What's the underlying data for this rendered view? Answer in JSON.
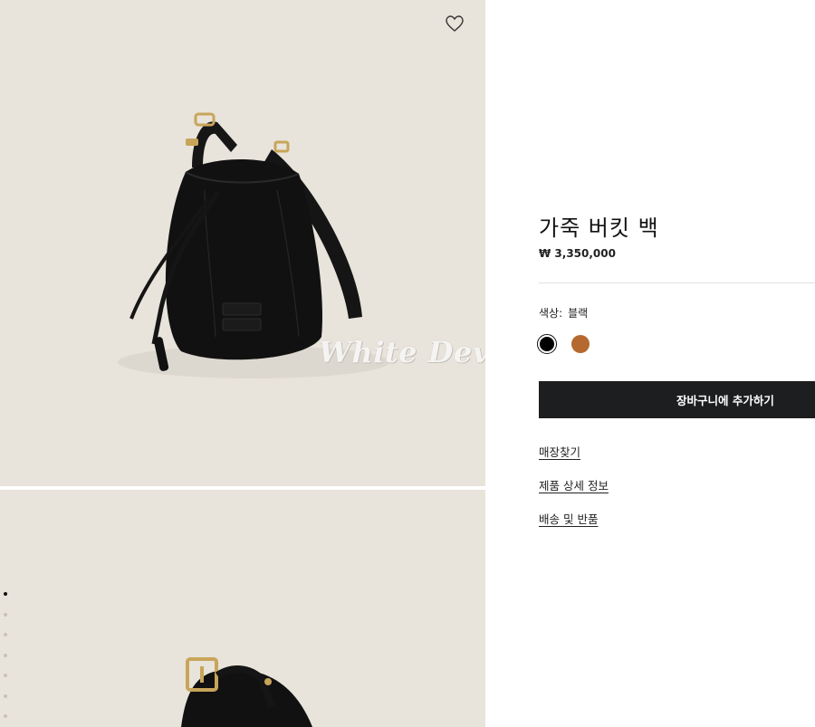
{
  "product": {
    "title": "가죽 버킷 백",
    "price": "₩ 3,350,000",
    "color_label": "색상:",
    "color_value": "블랙",
    "colors": [
      {
        "name": "블랙",
        "hex": "#000000"
      },
      {
        "name": "탄",
        "hex": "#b5692e"
      }
    ],
    "add_to_cart_label": "장바구니에 추가하기"
  },
  "links": {
    "store_finder": "매장찾기",
    "product_details": "제품 상세 정보",
    "shipping_returns": "배송 및 반품"
  },
  "gallery": {
    "watermark": "White Devil",
    "dot_count": 8,
    "active_dot": 1,
    "background_color": "#e8e3db"
  },
  "icons": {
    "wishlist": "heart-outline-icon"
  }
}
